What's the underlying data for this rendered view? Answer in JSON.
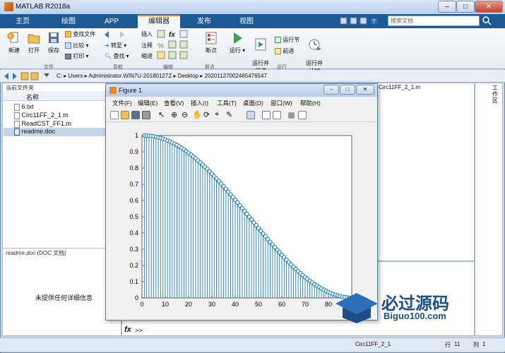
{
  "window": {
    "title": "MATLAB R2018a"
  },
  "tabs": [
    "主页",
    "绘图",
    "APP",
    "编辑器",
    "发布",
    "视图"
  ],
  "search": {
    "placeholder": "搜索文档"
  },
  "toolstrip": {
    "file": {
      "new": "新建",
      "open": "打开",
      "save": "保存",
      "find_files": "查找文件",
      "compare": "比较",
      "print": "打印",
      "group": "文件"
    },
    "nav": {
      "goto": "转至",
      "find": "查找",
      "group": "导航"
    },
    "edit": {
      "insert": "插入",
      "comment": "注释",
      "indent": "缩进",
      "fx": "fx",
      "group": "编辑"
    },
    "breakpoints": {
      "label": "断点",
      "group": "断点"
    },
    "run": {
      "run": "运行",
      "run_advance": "运行并\n前进",
      "run_section": "运行节",
      "advance": "前进",
      "run_time": "运行并\n计时",
      "group": "运行"
    }
  },
  "address": {
    "path": [
      "C:",
      "Users",
      "Administrator.WIN7U-20180127Z",
      "Desktop",
      "20201127002465476547"
    ]
  },
  "current_folder": {
    "title": "当前文件夹",
    "column_header": "名称",
    "files": [
      "6.txt",
      "Circ11FF_2_1.m",
      "ReadCST_FF1.m",
      "readme.doc"
    ],
    "selected": "readme.doc"
  },
  "details": {
    "title": "readme.doc  (DOC 文档)",
    "message": "未提供任何详细信息"
  },
  "editor": {
    "tab_label": "Circ11FF_2_1.m"
  },
  "workspace": {
    "label": "工作区"
  },
  "command": {
    "prompt": ">>",
    "fx": "fx"
  },
  "status": {
    "file": "Circ11FF_2_1",
    "row_label": "行",
    "row": "11",
    "col_label": "列",
    "col": "1"
  },
  "figure": {
    "title": "Figure 1",
    "menu": [
      "文件(F)",
      "编辑(E)",
      "查看(V)",
      "插入(I)",
      "工具(T)",
      "桌面(D)",
      "窗口(W)",
      "帮助(H)"
    ]
  },
  "watermark": {
    "text1": "必过源码",
    "text2": "Biguo100.com"
  },
  "chart_data": {
    "type": "stem",
    "x_start": 1,
    "x_end": 91,
    "function": "y = (cos(pi*(x-1)/180))^2 approx, decaying from 1 to 0",
    "xlim": [
      0,
      90
    ],
    "ylim": [
      0,
      1
    ],
    "xticks": [
      "0",
      "10",
      "20",
      "30",
      "40",
      "50",
      "60",
      "70",
      "80"
    ],
    "yticks": [
      "0",
      "0.1",
      "0.2",
      "0.3",
      "0.4",
      "0.5",
      "0.6",
      "0.7",
      "0.8",
      "0.9",
      "1"
    ],
    "color": "#0072bd"
  }
}
